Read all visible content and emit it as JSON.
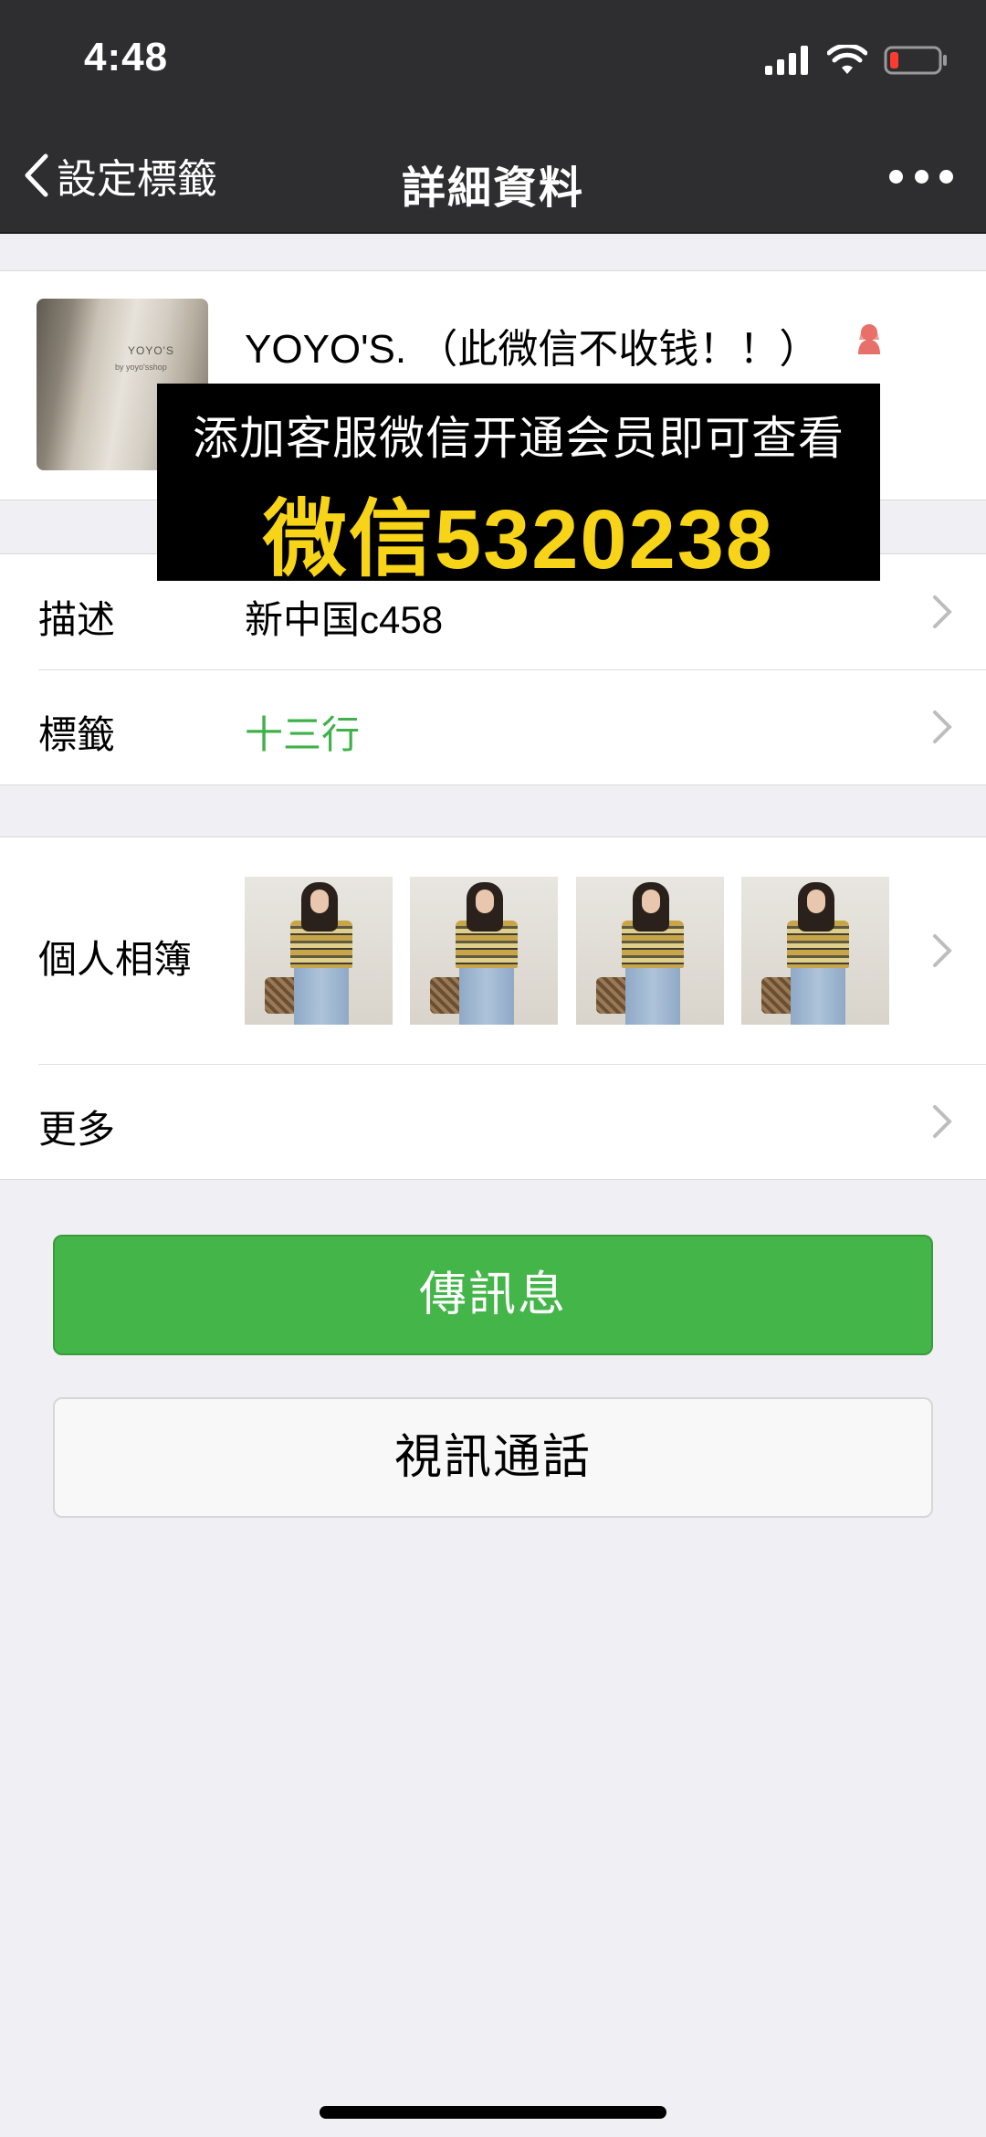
{
  "status_bar": {
    "time": "4:48"
  },
  "nav": {
    "back_label": "設定標籤",
    "title": "詳細資料"
  },
  "profile": {
    "name": "YOYO'S. （此微信不收钱！！）",
    "avatar_text_1": "YOYO'S",
    "avatar_text_2": "by yoyo'sshop"
  },
  "overlay": {
    "line1": "添加客服微信开通会员即可查看",
    "line2": "微信5320238"
  },
  "info_rows": [
    {
      "label": "描述",
      "value": "新中国c458"
    },
    {
      "label": "標籤",
      "value": "十三行"
    }
  ],
  "album": {
    "label": "個人相簿"
  },
  "more": {
    "label": "更多"
  },
  "buttons": {
    "message": "傳訊息",
    "video_call": "視訊通話"
  },
  "colors": {
    "nav_bg": "#2e2e30",
    "accent_green": "#44b549",
    "tag_green": "#3fb14a",
    "banner_yellow": "#f7d417"
  }
}
